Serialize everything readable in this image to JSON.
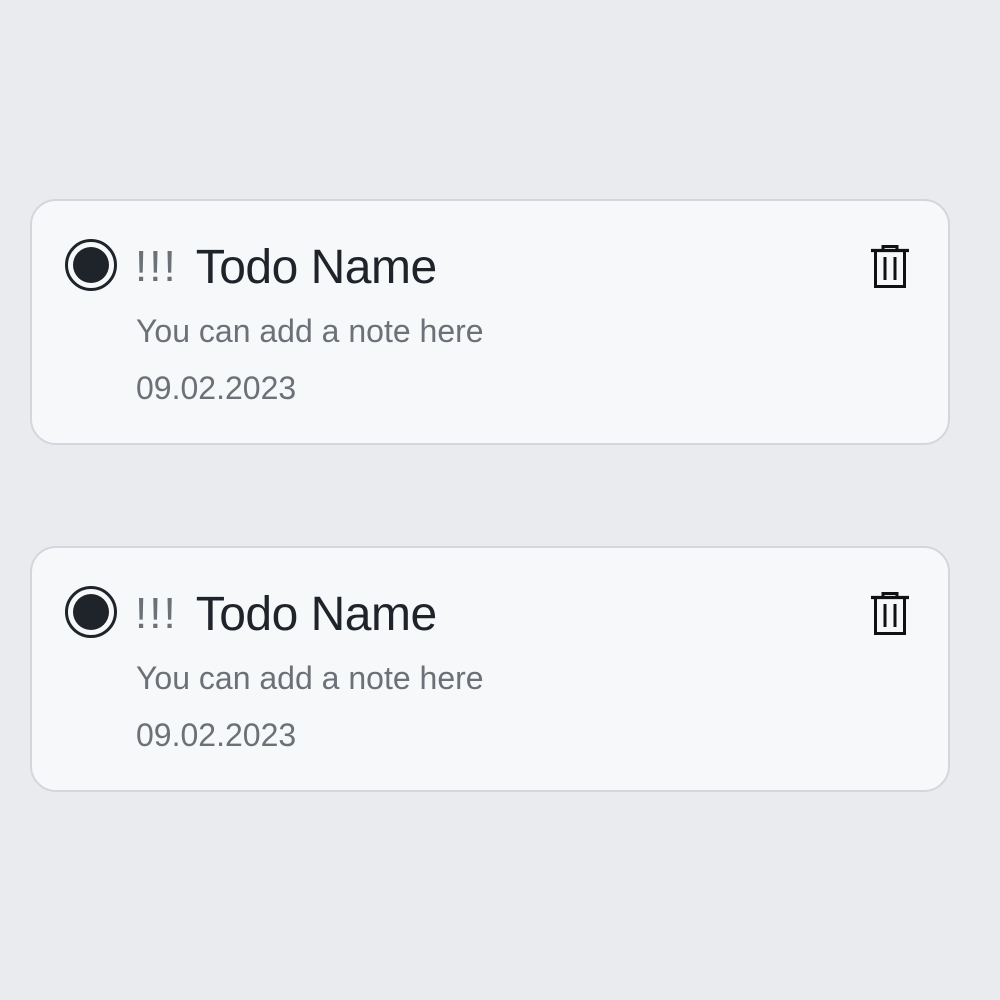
{
  "todos": [
    {
      "priority": "!!!",
      "name": "Todo Name",
      "note": "You can add a note here",
      "date": "09.02.2023",
      "checked": true,
      "delete_icon": "trash-icon"
    },
    {
      "priority": "!!!",
      "name": "Todo Name",
      "note": "You can add a note here",
      "date": "09.02.2023",
      "checked": true,
      "delete_icon": "trash-icon"
    }
  ],
  "colors": {
    "background": "#e9ebef",
    "card": "#f6f8fa",
    "card_border": "#d3d6db",
    "text_primary": "#1f232a",
    "text_secondary": "#6b7177"
  }
}
